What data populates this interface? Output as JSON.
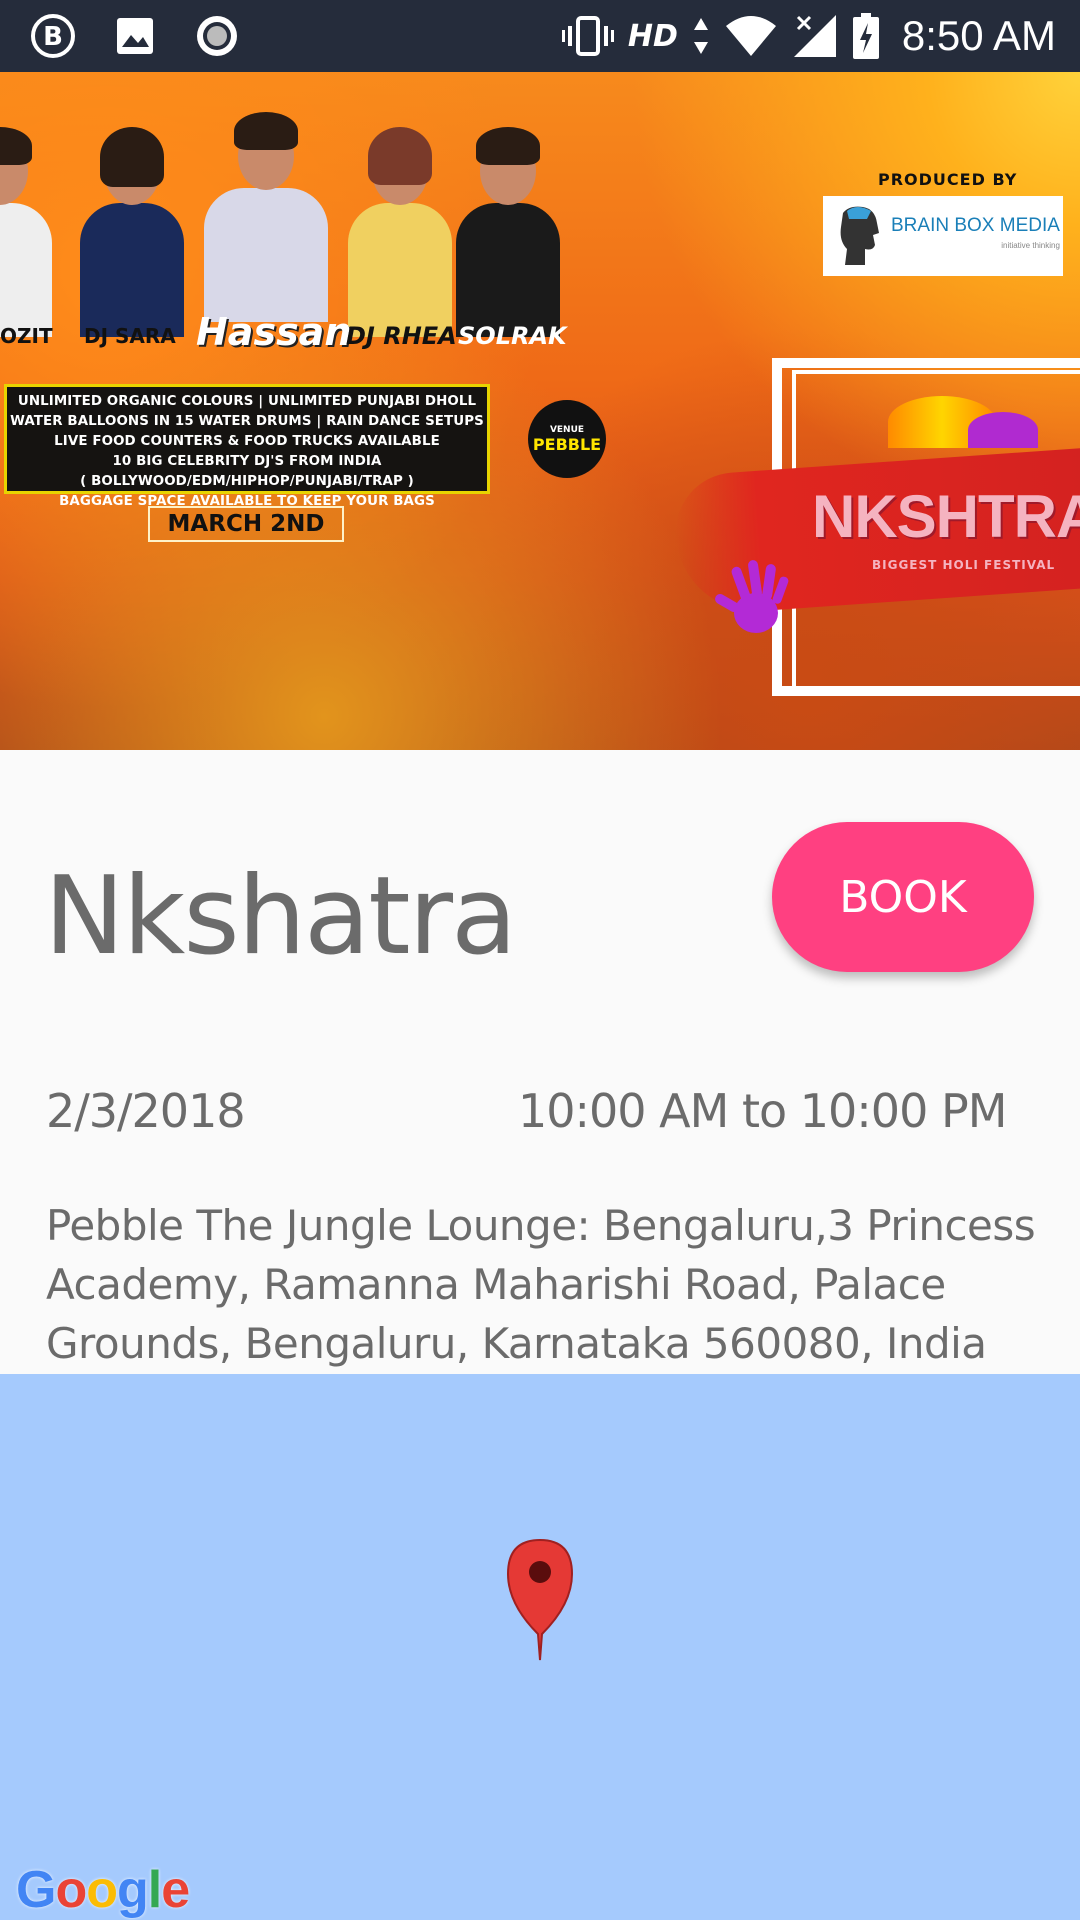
{
  "status_bar": {
    "hd_label": "HD",
    "time": "8:50 AM",
    "icons": [
      "b-circle-icon",
      "image-icon",
      "record-icon",
      "vibrate-icon",
      "data-arrows-icon",
      "wifi-icon",
      "signal-icon",
      "battery-charging-icon"
    ]
  },
  "banner": {
    "dj_names": [
      "OZIT",
      "DJ SARA",
      "Hassan",
      "DJ RHEA",
      "SOLRAK"
    ],
    "info_lines": [
      "UNLIMITED  ORGANIC COLOURS | UNLIMITED PUNJABI DHOLL",
      "WATER BALLOONS IN 15 WATER DRUMS | RAIN DANCE SETUPS",
      "LIVE FOOD COUNTERS & FOOD TRUCKS AVAILABLE",
      "10 BIG CELEBRITY DJ'S FROM INDIA",
      "( BOLLYWOOD/EDM/HIPHOP/PUNJABI/TRAP )",
      "BAGGAGE SPACE AVAILABLE TO KEEP YOUR BAGS"
    ],
    "date_label": "MARCH 2ND",
    "venue_small": "VENUE",
    "venue_name": "PEBBLE",
    "produced_by": "PRODUCED BY",
    "producer_name": "BRAIN BOX MEDIA",
    "producer_tagline": "initiative thinking",
    "festival_name": "NKSHTRA",
    "festival_sub": "BIGGEST HOLI FESTIVAL"
  },
  "event": {
    "title": "Nkshatra",
    "book_label": "BOOK",
    "date": "2/3/2018",
    "time": "10:00 AM to 10:00 PM",
    "address": "Pebble The Jungle Lounge: Bengaluru,3 Princess Academy, Ramanna Maharishi Road, Palace Grounds, Bengaluru, Karnataka 560080, India"
  },
  "map": {
    "background_color": "#a5cafd",
    "pin_color": "#e53935",
    "google_letters": [
      "G",
      "o",
      "o",
      "g",
      "l",
      "e"
    ],
    "google_colors": [
      "#4285f4",
      "#ea4335",
      "#fbbc05",
      "#4285f4",
      "#34a853",
      "#ea4335"
    ]
  },
  "colors": {
    "status_bar": "#252c3b",
    "accent": "#ff4081",
    "text": "#6b6b6b"
  }
}
